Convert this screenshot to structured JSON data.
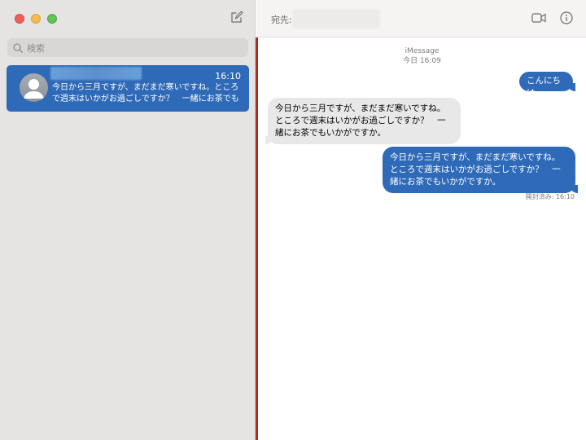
{
  "sidebar": {
    "search_placeholder": "検索",
    "conversations": [
      {
        "time": "16:10",
        "preview": "今日から三月ですが、まだまだ寒いですね。ところで週末はいかがお過ごしですか？　一緒にお茶でもい…",
        "selected": true
      }
    ]
  },
  "header": {
    "to_label": "宛先:"
  },
  "chat": {
    "service": "iMessage",
    "timestamp": "今日 16:09",
    "messages": [
      {
        "direction": "outgoing",
        "text": "こんにちは"
      },
      {
        "direction": "incoming",
        "text": "今日から三月ですが、まだまだ寒いですね。ところで週末はいかがお過ごしですか？　一緒にお茶でもいかがですか。"
      },
      {
        "direction": "outgoing",
        "text": "今日から三月ですが、まだまだ寒いですね。ところで週末はいかがお過ごしですか？　一緒にお茶でもいかがですか。"
      }
    ],
    "read_receipt": "開封済み: 16:10"
  },
  "colors": {
    "accent": "#2f6ab8",
    "sidebar_bg": "#e6e4e3",
    "incoming_bubble": "#e9e8e8",
    "divider": "#b12a1e"
  },
  "icons": [
    "compose-icon",
    "search-icon",
    "video-call-icon",
    "info-icon",
    "avatar-icon"
  ]
}
